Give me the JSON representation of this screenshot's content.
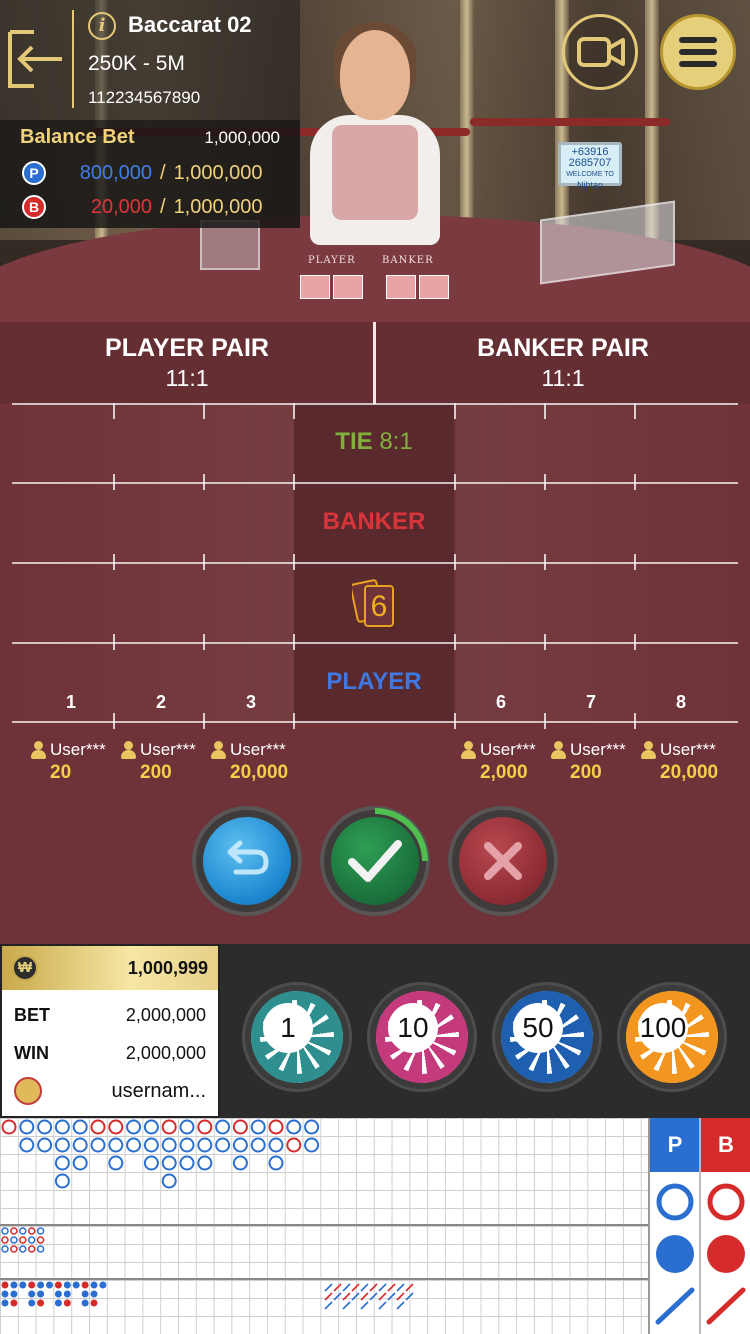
{
  "header": {
    "room_name": "Baccarat 02",
    "bet_limit": "250K - 5M",
    "round_id": "112234567890",
    "balance_bet_label": "Balance Bet",
    "balance_bet_value": "1,000,000",
    "player_bet": {
      "badge": "P",
      "current": "800,000",
      "separator": "/",
      "max": "1,000,000"
    },
    "banker_bet": {
      "badge": "B",
      "current": "20,000",
      "separator": "/",
      "max": "1,000,000"
    }
  },
  "video": {
    "lcd_line1": "+63916",
    "lcd_line2": "2685707",
    "lcd_line3": "WELCOME TO",
    "lcd_line4": "Nihtan",
    "table_label_player": "PLAYER",
    "table_label_banker": "BANKER"
  },
  "bet_table": {
    "player_pair": {
      "label": "PLAYER PAIR",
      "odds": "11:1"
    },
    "banker_pair": {
      "label": "BANKER PAIR",
      "odds": "11:1"
    },
    "tie": {
      "label": "TIE",
      "odds": "8:1"
    },
    "banker": {
      "label": "BANKER"
    },
    "player": {
      "label": "PLAYER"
    },
    "card_count": "6",
    "seats": [
      "1",
      "2",
      "3",
      "6",
      "7",
      "8"
    ],
    "users": [
      {
        "name": "User***",
        "amount": "20"
      },
      {
        "name": "User***",
        "amount": "200"
      },
      {
        "name": "User***",
        "amount": "20,000"
      },
      {
        "name": "User***",
        "amount": "2,000"
      },
      {
        "name": "User***",
        "amount": "200"
      },
      {
        "name": "User***",
        "amount": "20,000"
      }
    ]
  },
  "actions": {
    "undo": "undo-icon",
    "confirm": "check-icon",
    "cancel": "close-icon"
  },
  "wallet": {
    "currency_symbol": "₩",
    "balance": "1,000,999",
    "bet_label": "BET",
    "bet_value": "2,000,000",
    "win_label": "WIN",
    "win_value": "2,000,000",
    "username": "usernam..."
  },
  "chips": [
    {
      "value": "1",
      "color": "#2f8f8f"
    },
    {
      "value": "10",
      "color": "#c43a7d"
    },
    {
      "value": "50",
      "color": "#1f5fb0"
    },
    {
      "value": "100",
      "color": "#f2961f"
    }
  ],
  "prediction": {
    "player_label": "P",
    "banker_label": "B",
    "player_color": "#2a6fd0",
    "banker_color": "#d62b2b"
  },
  "colors": {
    "gold": "#e3c878",
    "felt": "#6e3238",
    "tie": "#7fb23a",
    "banker": "#d9343a",
    "player": "#3f78e0"
  }
}
